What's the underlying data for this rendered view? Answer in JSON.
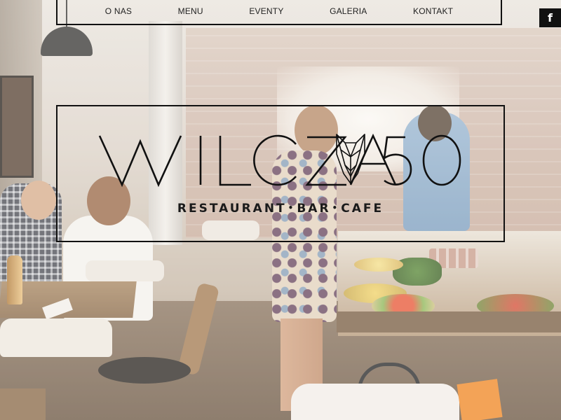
{
  "nav": {
    "items": [
      {
        "label": "O NAS"
      },
      {
        "label": "MENU"
      },
      {
        "label": "EVENTY"
      },
      {
        "label": "GALERIA"
      },
      {
        "label": "KONTAKT"
      }
    ]
  },
  "social": {
    "facebook_label": "f",
    "facebook_icon": "facebook-icon"
  },
  "logo": {
    "word_left": "WILCZA",
    "number": "50",
    "emblem_icon": "wolf-head-icon",
    "tagline_part1": "RESTAURANT",
    "tagline_part2": "BAR",
    "tagline_part3": "CAFE",
    "separator": "•"
  },
  "colors": {
    "border": "#111111",
    "text": "#222222",
    "facebook_bg": "#111111",
    "facebook_fg": "#ffffff"
  }
}
